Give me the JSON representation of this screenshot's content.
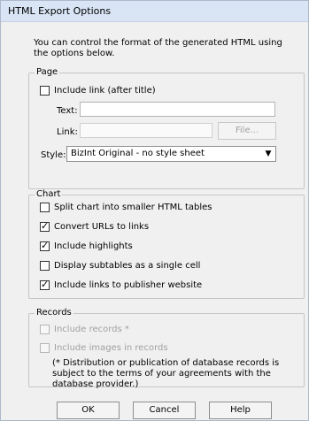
{
  "dialog": {
    "title": "HTML Export Options",
    "intro": "You can control the format of the generated HTML using the options below."
  },
  "page": {
    "legend": "Page",
    "include_link_label": "Include link (after title)",
    "include_link_checked": false,
    "text_label": "Text:",
    "text_value": "",
    "link_label": "Link:",
    "link_value": "",
    "file_button": "File...",
    "style_label": "Style:",
    "style_value": "BizInt Original - no style sheet",
    "dropdown_icon": "chevron-down-icon"
  },
  "chart": {
    "legend": "Chart",
    "options": [
      {
        "label": "Split chart into smaller HTML tables",
        "checked": false
      },
      {
        "label": "Convert URLs to links",
        "checked": true
      },
      {
        "label": "Include highlights",
        "checked": true
      },
      {
        "label": "Display subtables as a single cell",
        "checked": false
      },
      {
        "label": "Include links to publisher website",
        "checked": true
      }
    ]
  },
  "records": {
    "legend": "Records",
    "options": [
      {
        "label": "Include records *",
        "checked": false,
        "enabled": false
      },
      {
        "label": "Include images in records",
        "checked": false,
        "enabled": false
      }
    ],
    "note": "(* Distribution or publication of database records is subject to the terms of your agreements with the database provider.)"
  },
  "buttons": {
    "ok": "OK",
    "cancel": "Cancel",
    "help": "Help"
  }
}
